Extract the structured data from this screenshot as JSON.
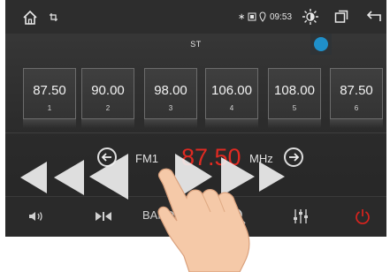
{
  "status_bar": {
    "home_icon": "home-icon",
    "screenshot_icon": "screenshot-icon",
    "bluetooth_icon": "bluetooth-icon",
    "sd_card_icon": "sd-card-icon",
    "location_icon": "location-icon",
    "time": "09:53",
    "brightness_icon": "brightness-icon",
    "window_icon": "window-icon",
    "back_icon": "back-icon"
  },
  "radio": {
    "stereo_indicator": "ST",
    "band": "FM1",
    "frequency": "87.50",
    "unit": "MHz",
    "presets": [
      {
        "freq": "87.50",
        "num": "1"
      },
      {
        "freq": "90.00",
        "num": "2"
      },
      {
        "freq": "98.00",
        "num": "3"
      },
      {
        "freq": "106.00",
        "num": "4"
      },
      {
        "freq": "108.00",
        "num": "5"
      },
      {
        "freq": "87.50",
        "num": "6"
      }
    ]
  },
  "bottom_bar": {
    "band_label": "BAND",
    "items": [
      "volume-icon",
      "seek-icon",
      "band",
      "search-icon",
      "equalizer-icon",
      "power-icon"
    ]
  },
  "colors": {
    "frequency": "#e02a22",
    "power": "#d8231e",
    "rds_dot": "#1f8fc9"
  }
}
